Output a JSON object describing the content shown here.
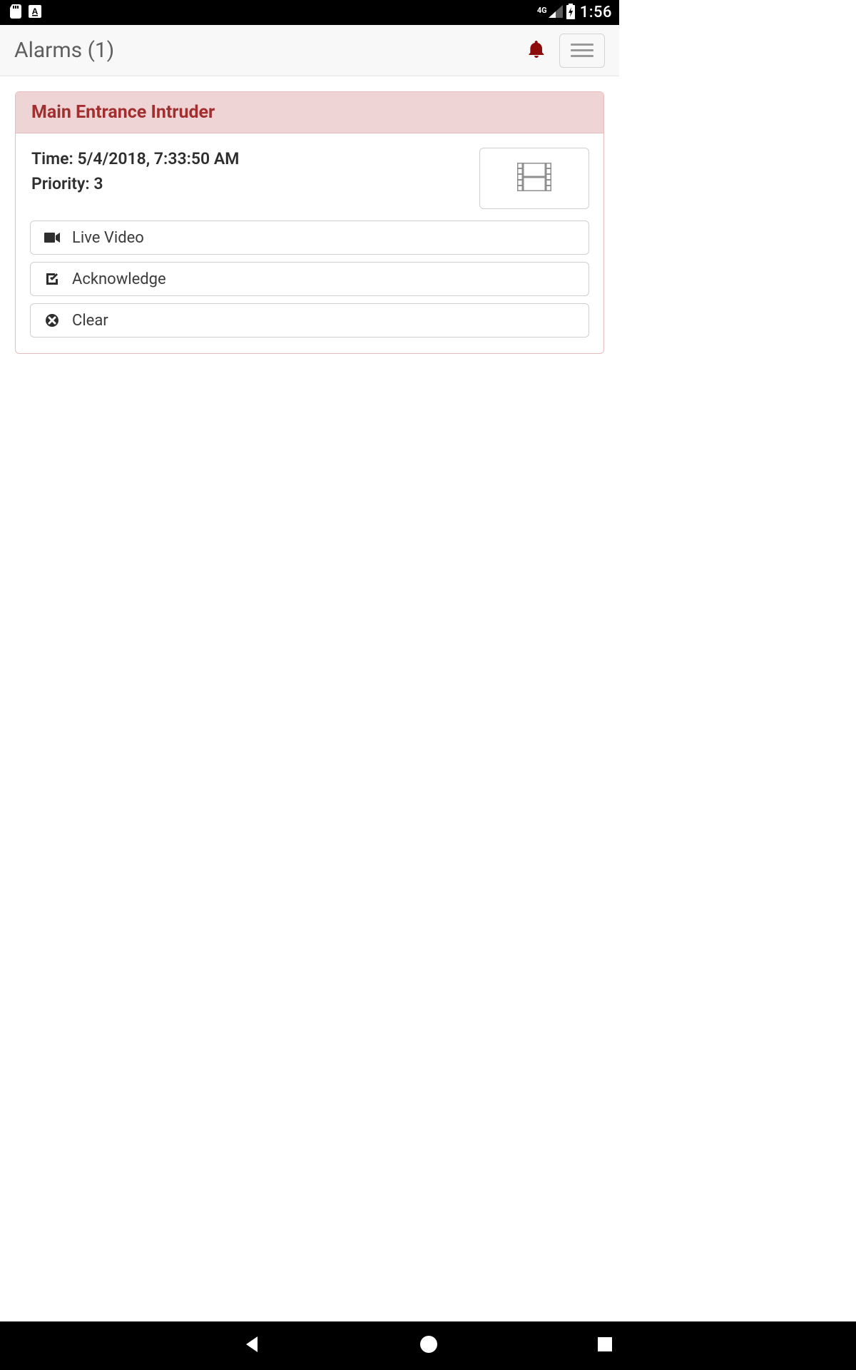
{
  "statusbar": {
    "network_label": "4G",
    "time": "1:56"
  },
  "header": {
    "title": "Alarms (1)"
  },
  "alarm": {
    "title": "Main Entrance Intruder",
    "time_label": "Time: ",
    "time_value": "5/4/2018, 7:33:50 AM",
    "priority_label": "Priority: ",
    "priority_value": "3",
    "actions": {
      "live_video": "Live Video",
      "acknowledge": "Acknowledge",
      "clear": "Clear"
    }
  },
  "colors": {
    "alert_accent": "#a12f2f",
    "alert_bg": "#efd4d6"
  }
}
